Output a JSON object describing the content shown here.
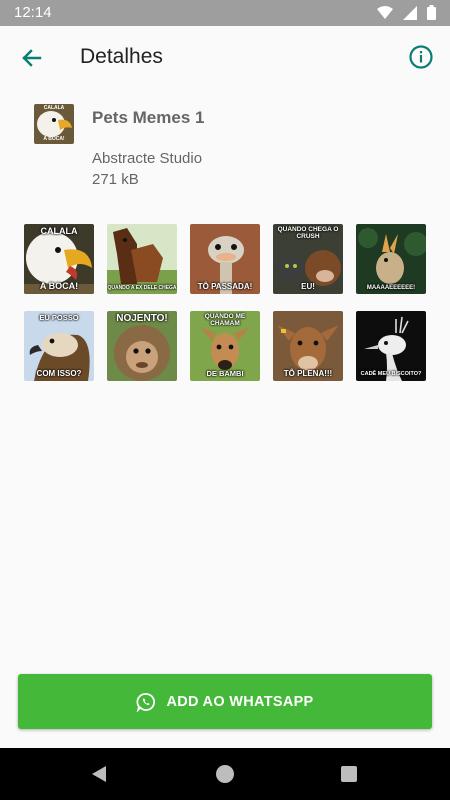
{
  "status_bar": {
    "time": "12:14",
    "icons": [
      "wifi-icon",
      "signal-icon",
      "battery-icon"
    ]
  },
  "app_bar": {
    "title": "Detalhes",
    "back_icon": "arrow-left-icon",
    "info_icon": "info-icon",
    "accent_color": "#0a7e74"
  },
  "pack": {
    "tray_caption_top": "CALALA",
    "tray_caption_bottom": "A BOCA!",
    "name": "Pets Memes 1",
    "publisher": "Abstracte Studio",
    "size": "271 kB"
  },
  "stickers": [
    {
      "top": "CALALA",
      "bottom": "A BOCA!",
      "subject": "eagle"
    },
    {
      "top": "",
      "bottom": "QUANDO A EX DELE CHEGA",
      "subject": "horses"
    },
    {
      "top": "",
      "bottom": "TÔ PASSADA!",
      "subject": "ostrich"
    },
    {
      "top": "QUANDO CHEGA O CRUSH",
      "bottom": "EU!",
      "subject": "cat-and-cow"
    },
    {
      "top": "",
      "bottom": "MAAAAEEEEEE!",
      "subject": "chick"
    },
    {
      "top": "EU POSSO",
      "bottom": "COM ISSO?",
      "subject": "eagle-profile"
    },
    {
      "top": "NOJENTO!",
      "bottom": "",
      "subject": "monkey"
    },
    {
      "top": "QUANDO ME CHAMAM",
      "bottom": "DE BAMBI",
      "subject": "deer"
    },
    {
      "top": "",
      "bottom": "TÔ PLENA!!!",
      "subject": "calf"
    },
    {
      "top": "",
      "bottom": "CADÊ MEU BISCOITO?",
      "subject": "white-peacock"
    }
  ],
  "add_button": {
    "label": "ADD AO WHATSAPP",
    "icon": "whatsapp-icon",
    "color": "#44b839"
  },
  "nav_bar": {
    "icons": [
      "nav-back-icon",
      "nav-home-icon",
      "nav-recents-icon"
    ]
  }
}
